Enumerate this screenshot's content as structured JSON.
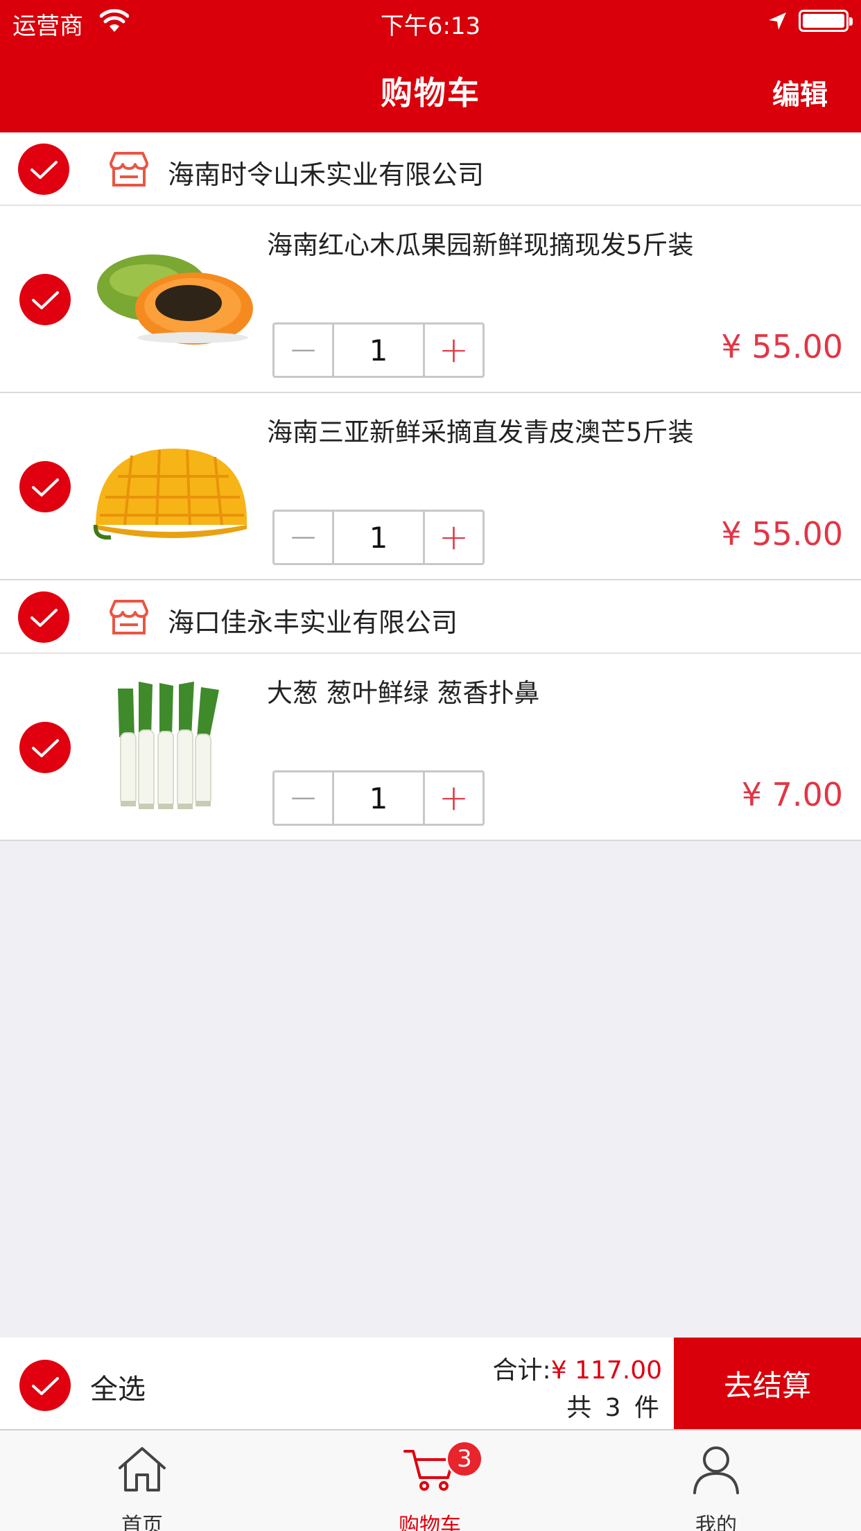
{
  "status_bar": {
    "carrier": "运营商",
    "time": "下午6:13"
  },
  "nav": {
    "title": "购物车",
    "edit_label": "编辑"
  },
  "shops": [
    {
      "name": "海南时令山禾实业有限公司",
      "items": [
        {
          "name": "海南红心木瓜果园新鲜现摘现发5斤装",
          "quantity": "1",
          "price": "¥ 55.00",
          "image": "papaya"
        },
        {
          "name": "海南三亚新鲜采摘直发青皮澳芒5斤装",
          "quantity": "1",
          "price": "¥ 55.00",
          "image": "mango"
        }
      ]
    },
    {
      "name": "海口佳永丰实业有限公司",
      "items": [
        {
          "name": "大葱 葱叶鲜绿 葱香扑鼻",
          "quantity": "1",
          "price": "¥ 7.00",
          "image": "scallion"
        }
      ]
    }
  ],
  "stepper": {
    "minus": "−",
    "plus": "+"
  },
  "checkout": {
    "select_all_label": "全选",
    "total_label": "合计:",
    "total_amount": "¥ 117.00",
    "count_text": "共 3 件",
    "button_label": "去结算"
  },
  "tabbar": {
    "tabs": [
      {
        "label": "首页",
        "icon": "home-icon"
      },
      {
        "label": "购物车",
        "icon": "cart-icon",
        "badge": "3"
      },
      {
        "label": "我的",
        "icon": "user-icon"
      }
    ]
  },
  "colors": {
    "brand": "#d9000b",
    "price": "#e23545",
    "background": "#efeff4"
  }
}
